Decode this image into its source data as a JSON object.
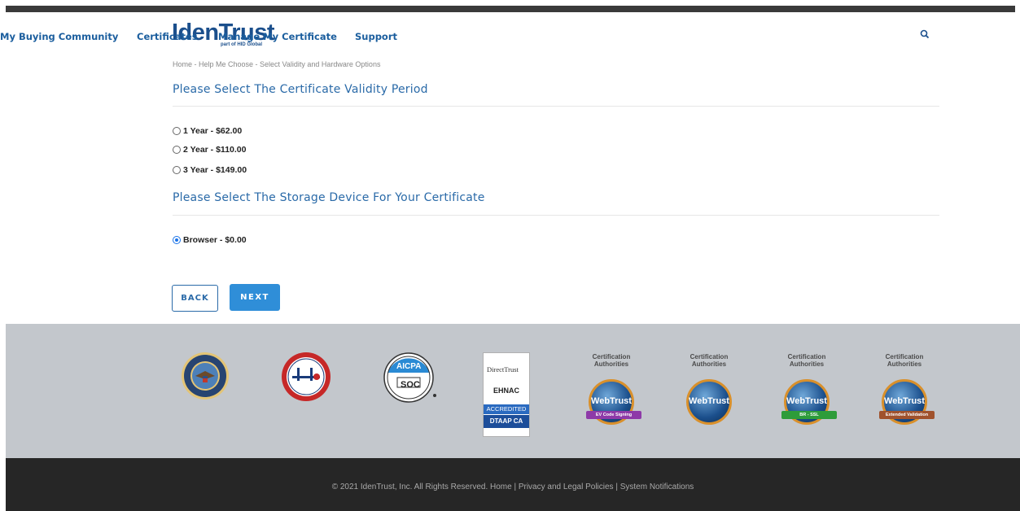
{
  "header": {
    "logo_main_left": "Iden",
    "logo_main_right": "Trust",
    "logo_sub": "part of HID Global",
    "nav": [
      {
        "label": "My Buying Community"
      },
      {
        "label": "Certificates"
      },
      {
        "label": "Manage My Certificate"
      },
      {
        "label": "Support"
      }
    ]
  },
  "breadcrumb": "Home - Help Me Choose - Select Validity and Hardware Options",
  "validity": {
    "title": "Please Select The Certificate Validity Period",
    "options": [
      {
        "label": "1 Year - $62.00",
        "selected": false
      },
      {
        "label": "2 Year - $110.00",
        "selected": false
      },
      {
        "label": "3 Year - $149.00",
        "selected": false
      }
    ]
  },
  "storage": {
    "title": "Please Select The Storage Device For Your Certificate",
    "options": [
      {
        "label": "Browser - $0.00",
        "selected": true
      }
    ]
  },
  "buttons": {
    "back": "BACK",
    "next": "NEXT"
  },
  "footer": {
    "seals": {
      "aicpa": "AICPA",
      "soc": "SOC",
      "directtrust": "DirectTrust",
      "ehnac": "EHNAC",
      "accredited": "ACCREDITED",
      "dtaap": "DTAAP CA",
      "webtrust_title": "Certification Authorities",
      "webtrust": "WebTrust",
      "wt_ribbons": [
        "EV Code Signing",
        "",
        "BR - SSL",
        "Extended Validation"
      ]
    },
    "copyright": "© 2021 IdenTrust, Inc. All Rights Reserved. Home | Privacy and Legal Policies | System Notifications"
  },
  "colors": {
    "accent": "#2a6aa8",
    "nav": "#1b5e9e",
    "next_button": "#2f8ed8",
    "footer_logos_bg": "#c3c7cc",
    "footer_bottom_bg": "#262626"
  }
}
